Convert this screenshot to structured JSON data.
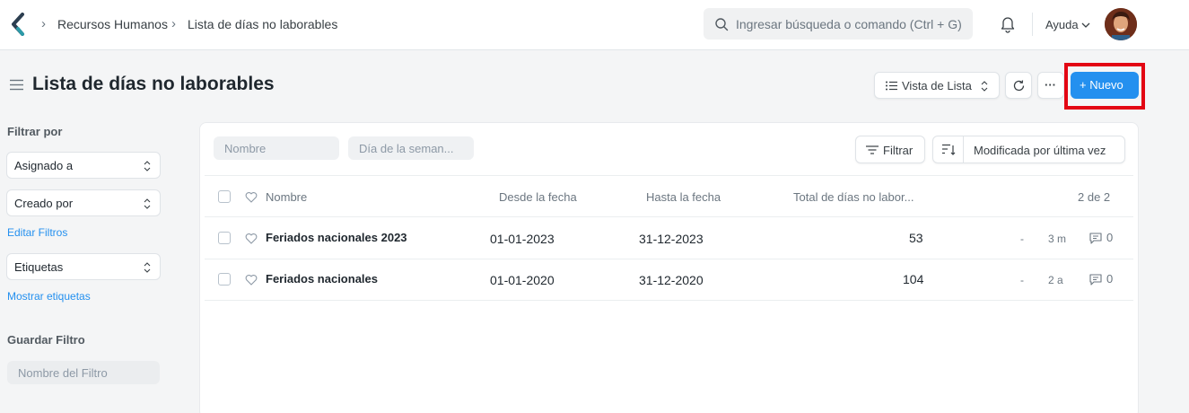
{
  "navbar": {
    "breadcrumbs": [
      "Recursos Humanos",
      "Lista de días no laborables"
    ],
    "search_placeholder": "Ingresar búsqueda o comando (Ctrl + G)",
    "help_label": "Ayuda"
  },
  "page": {
    "title": "Lista de días no laborables",
    "view_switcher_label": "Vista de Lista",
    "more_label": "···",
    "new_button_label": "+ Nuevo"
  },
  "sidebar": {
    "filter_by_label": "Filtrar por",
    "assigned_to": "Asignado a",
    "created_by": "Creado por",
    "edit_filters": "Editar Filtros",
    "tags": "Etiquetas",
    "show_tags": "Mostrar etiquetas",
    "save_filter_label": "Guardar Filtro",
    "filter_name_placeholder": "Nombre del Filtro"
  },
  "list": {
    "filters": {
      "name_placeholder": "Nombre",
      "weekday_placeholder": "Día de la seman..."
    },
    "filter_button": "Filtrar",
    "sort_label": "Modificada por última vez",
    "columns": [
      "Nombre",
      "Desde la fecha",
      "Hasta la fecha",
      "Total de días no labor..."
    ],
    "count": "2 de 2",
    "rows": [
      {
        "name": "Feriados nacionales 2023",
        "from": "01-01-2023",
        "to": "31-12-2023",
        "total": "53",
        "dash": "-",
        "modified": "3 m",
        "comments": "0"
      },
      {
        "name": "Feriados nacionales",
        "from": "01-01-2020",
        "to": "31-12-2020",
        "total": "104",
        "dash": "-",
        "modified": "2 a",
        "comments": "0"
      }
    ]
  },
  "colors": {
    "primary": "#2490ef",
    "highlight": "#e30613"
  }
}
